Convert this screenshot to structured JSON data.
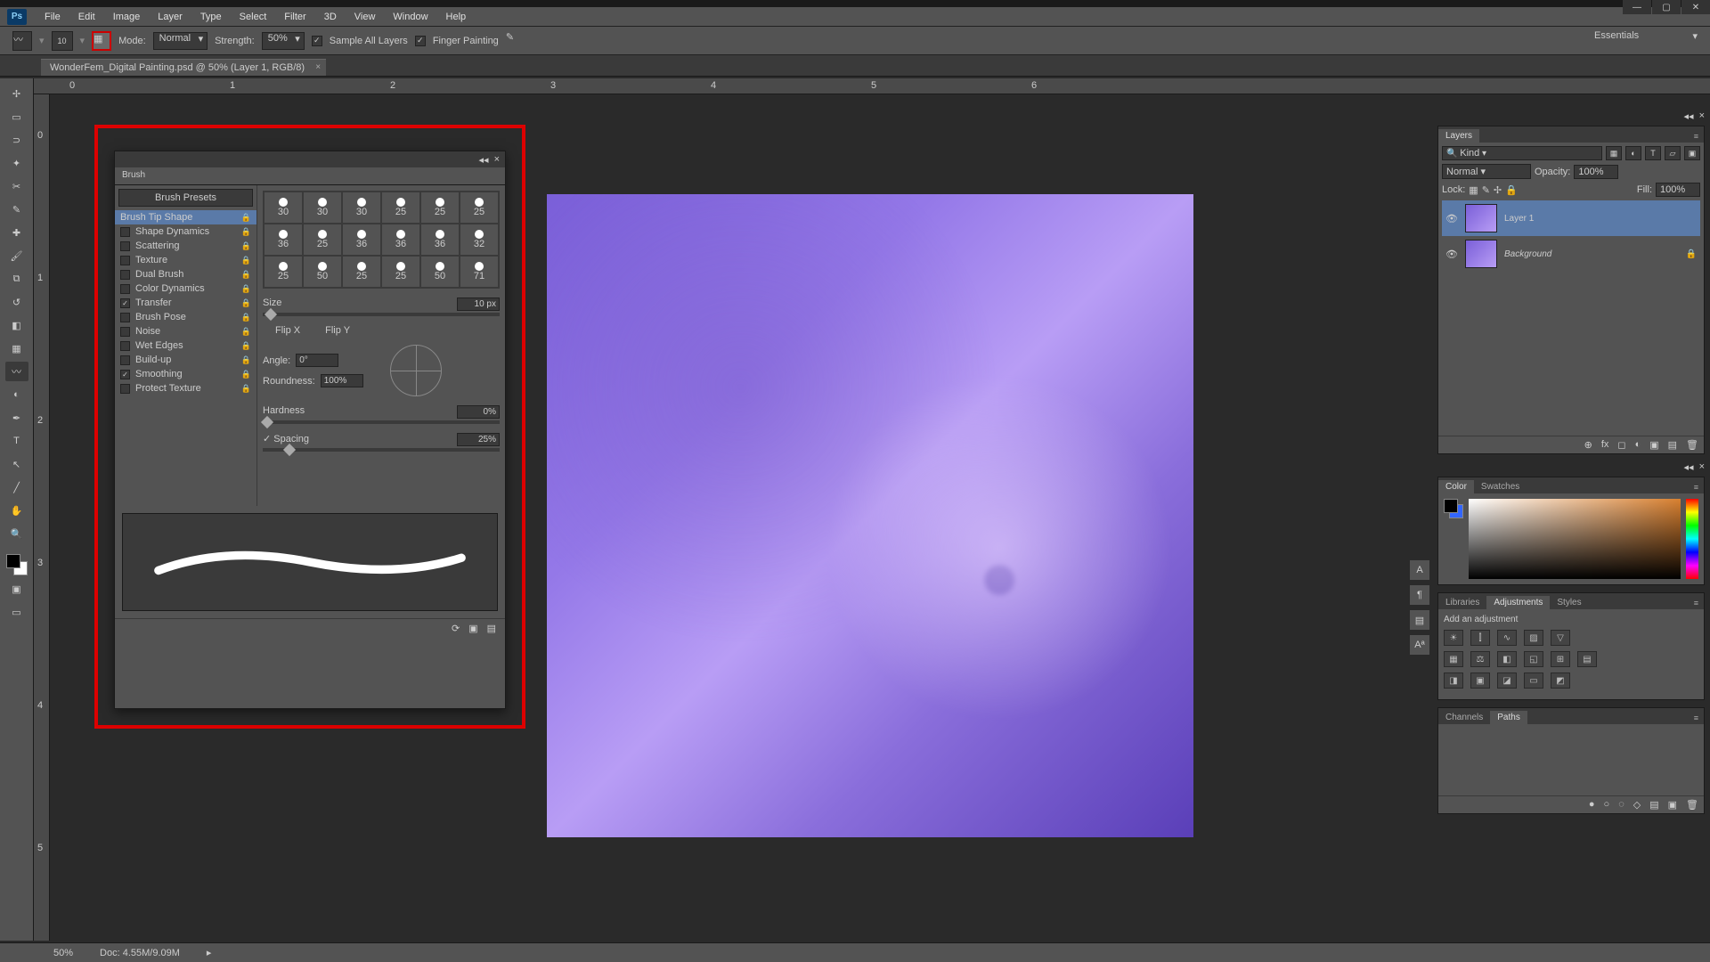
{
  "app": {
    "logo": "Ps"
  },
  "menu": [
    "File",
    "Edit",
    "Image",
    "Layer",
    "Type",
    "Select",
    "Filter",
    "3D",
    "View",
    "Window",
    "Help"
  ],
  "options": {
    "size_num": "10",
    "mode_label": "Mode:",
    "mode_value": "Normal",
    "strength_label": "Strength:",
    "strength_value": "50%",
    "sample_all": "Sample All Layers",
    "finger": "Finger Painting"
  },
  "workspace": "Essentials",
  "doc": {
    "tab": "WonderFem_Digital Painting.psd @ 50% (Layer 1, RGB/8)"
  },
  "ruler_h": [
    "0",
    "1",
    "2",
    "3",
    "4",
    "5",
    "6"
  ],
  "ruler_v": [
    "0",
    "1",
    "2",
    "3",
    "4",
    "5"
  ],
  "brush": {
    "tab": "Brush",
    "presets_btn": "Brush Presets",
    "settings": [
      {
        "label": "Brush Tip Shape",
        "checked": false,
        "active": true,
        "enabled": true
      },
      {
        "label": "Shape Dynamics",
        "checked": false,
        "enabled": true
      },
      {
        "label": "Scattering",
        "checked": false,
        "enabled": true
      },
      {
        "label": "Texture",
        "checked": false,
        "enabled": false
      },
      {
        "label": "Dual Brush",
        "checked": false,
        "enabled": false
      },
      {
        "label": "Color Dynamics",
        "checked": false,
        "enabled": false
      },
      {
        "label": "Transfer",
        "checked": true,
        "enabled": true
      },
      {
        "label": "Brush Pose",
        "checked": false,
        "enabled": true
      },
      {
        "label": "Noise",
        "checked": false,
        "enabled": true
      },
      {
        "label": "Wet Edges",
        "checked": false,
        "enabled": false
      },
      {
        "label": "Build-up",
        "checked": false,
        "enabled": false
      },
      {
        "label": "Smoothing",
        "checked": true,
        "enabled": true
      },
      {
        "label": "Protect Texture",
        "checked": false,
        "enabled": false
      }
    ],
    "grid_sizes": [
      "30",
      "30",
      "30",
      "25",
      "25",
      "25",
      "36",
      "25",
      "36",
      "36",
      "36",
      "32",
      "25",
      "50",
      "25",
      "25",
      "50",
      "71"
    ],
    "size_label": "Size",
    "size_value": "10 px",
    "flipx": "Flip X",
    "flipy": "Flip Y",
    "angle_label": "Angle:",
    "angle_value": "0°",
    "round_label": "Roundness:",
    "round_value": "100%",
    "hard_label": "Hardness",
    "hard_value": "0%",
    "spacing_label": "Spacing",
    "spacing_value": "25%"
  },
  "layers": {
    "tab": "Layers",
    "kind": "Kind",
    "blend": "Normal",
    "opacity_label": "Opacity:",
    "opacity": "100%",
    "lock_label": "Lock:",
    "fill_label": "Fill:",
    "fill": "100%",
    "items": [
      {
        "name": "Layer 1",
        "active": true,
        "locked": false
      },
      {
        "name": "Background",
        "active": false,
        "locked": true
      }
    ]
  },
  "color": {
    "tab1": "Color",
    "tab2": "Swatches"
  },
  "adjust": {
    "tab1": "Libraries",
    "tab2": "Adjustments",
    "tab3": "Styles",
    "add": "Add an adjustment"
  },
  "channels": {
    "tab1": "Channels",
    "tab2": "Paths"
  },
  "status": {
    "zoom": "50%",
    "doc": "Doc: 4.55M/9.09M"
  }
}
